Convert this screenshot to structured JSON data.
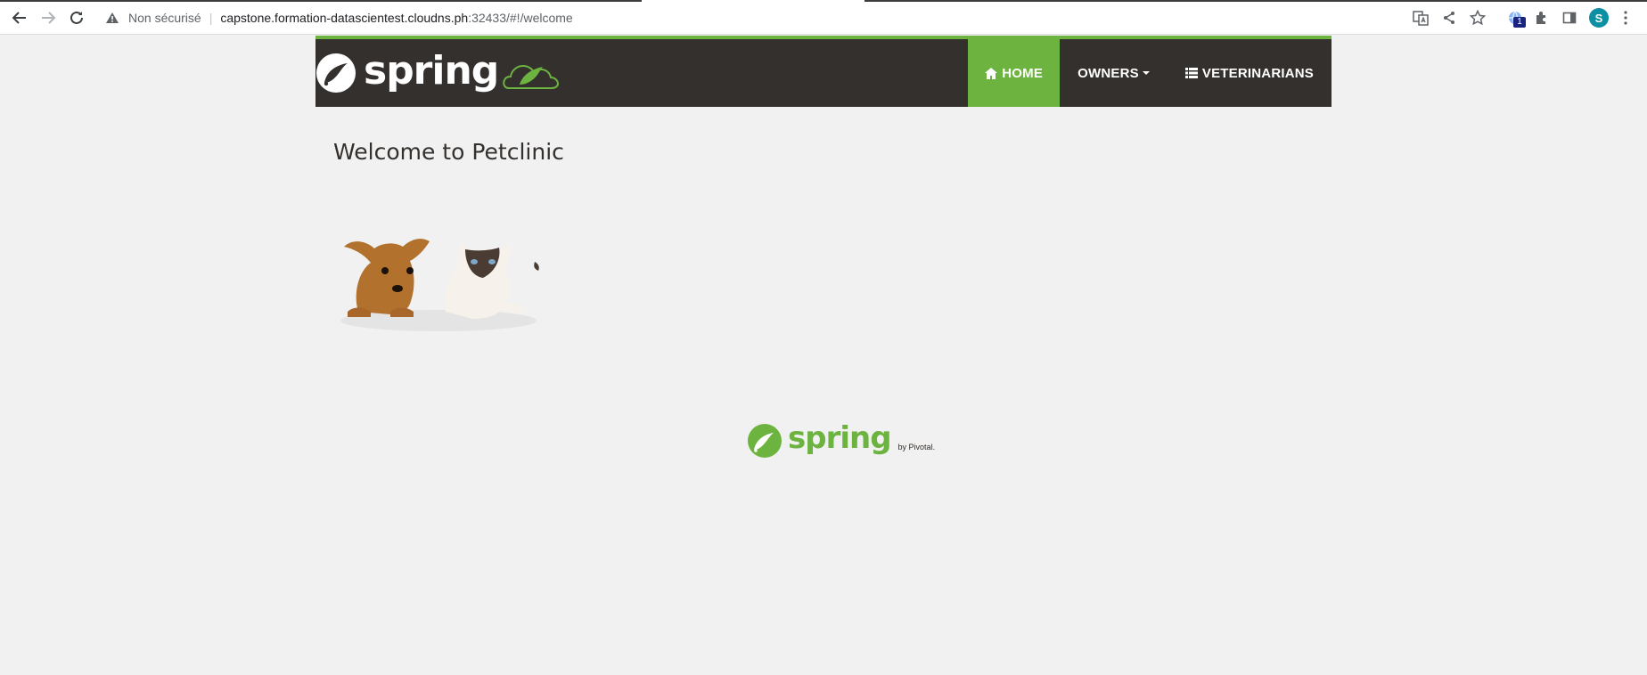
{
  "browser": {
    "security_label": "Non sécurisé",
    "url_host": "capstone.formation-datascientest.cloudns.ph",
    "url_path": ":32433/#!/welcome",
    "profile_initial": "S",
    "extension_badge": "1"
  },
  "navbar": {
    "brand": "spring",
    "items": [
      {
        "label": "HOME",
        "icon": "home-icon",
        "active": true
      },
      {
        "label": "OWNERS",
        "icon": "",
        "dropdown": true
      },
      {
        "label": "VETERINARIANS",
        "icon": "list-icon"
      }
    ]
  },
  "main": {
    "title": "Welcome to Petclinic"
  },
  "footer": {
    "brand": "spring",
    "byline": "by Pivotal."
  },
  "colors": {
    "spring_green": "#6db33f",
    "nav_dark": "#34302d",
    "page_bg": "#f1f1f1"
  }
}
